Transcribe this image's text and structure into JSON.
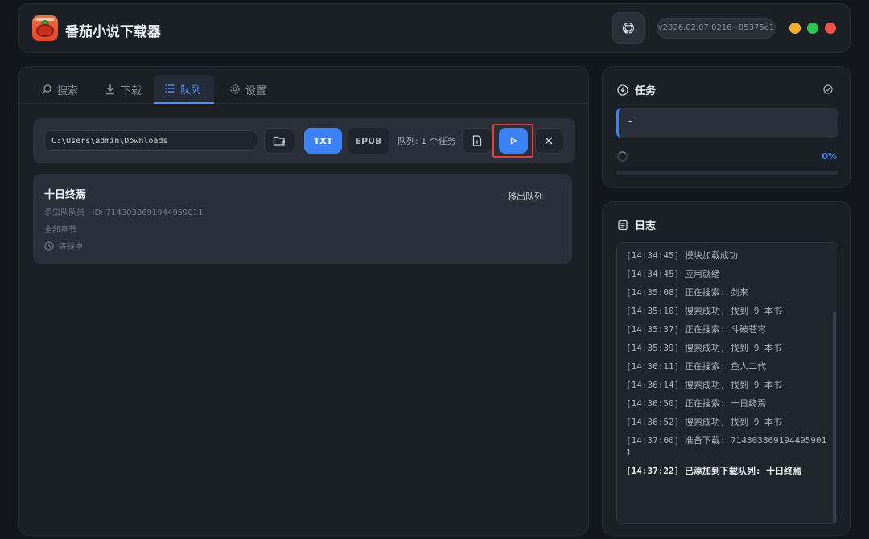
{
  "app": {
    "title": "番茄小说下载器",
    "version": "v2026.02.07.0216+85375e1"
  },
  "tabs": [
    {
      "label": "搜索"
    },
    {
      "label": "下载"
    },
    {
      "label": "队列"
    },
    {
      "label": "设置"
    }
  ],
  "toolbar": {
    "path_value": "C:\\Users\\admin\\Downloads",
    "format_txt": "TXT",
    "format_epub": "EPUB",
    "queue_count": "队列: 1 个任务"
  },
  "queue": [
    {
      "title": "十日终焉",
      "meta": "杀虫队队员 · ID: 7143038691944959011",
      "scope": "全部章节",
      "status": "等待中",
      "remove_label": "移出队列"
    }
  ],
  "task_panel": {
    "title": "任务",
    "progress_text": "-",
    "percent": "0%",
    "progress_value": 0
  },
  "log_panel": {
    "title": "日志",
    "lines": [
      "[14:34:45] 模块加载成功",
      "[14:34:45] 应用就绪",
      "[14:35:08] 正在搜索: 剑来",
      "[14:35:10] 搜索成功, 找到 9 本书",
      "[14:35:37] 正在搜索: 斗破苍穹",
      "[14:35:39] 搜索成功, 找到 9 本书",
      "[14:36:11] 正在搜索: 鱼人二代",
      "[14:36:14] 搜索成功, 找到 9 本书",
      "[14:36:50] 正在搜索: 十日终焉",
      "[14:36:52] 搜索成功, 找到 9 本书",
      "[14:37:00] 准备下载: 7143038691944959011",
      "[14:37:22] 已添加到下载队列: 十日终焉"
    ]
  },
  "colors": {
    "accent": "#3b82f6",
    "highlight": "#e0423b"
  },
  "icons": {
    "github": "github-icon",
    "search": "search-icon",
    "download": "download-icon",
    "queue": "list-icon",
    "settings": "gear-icon",
    "folder": "folder-plus-icon",
    "file": "file-plus-icon",
    "play": "play-icon",
    "close": "close-icon",
    "clock": "clock-icon",
    "task": "download-circle-icon",
    "check": "check-circle-icon",
    "log": "document-icon"
  }
}
